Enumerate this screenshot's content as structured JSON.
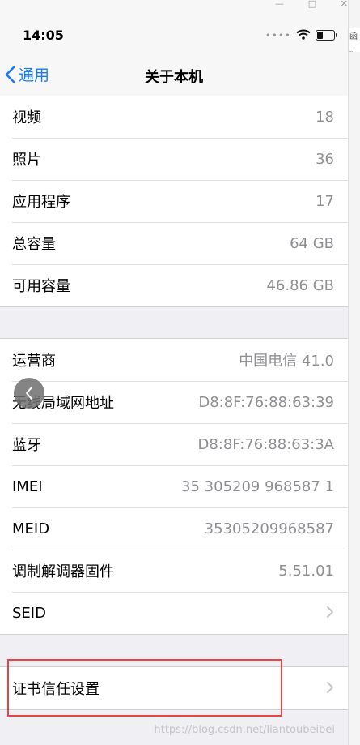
{
  "status_bar": {
    "time": "14:05",
    "signal": "••••"
  },
  "nav": {
    "back_label": "通用",
    "title": "关于本机"
  },
  "side_tab": {
    "text": "函数"
  },
  "group1": [
    {
      "label": "视频",
      "value": "18"
    },
    {
      "label": "照片",
      "value": "36"
    },
    {
      "label": "应用程序",
      "value": "17"
    },
    {
      "label": "总容量",
      "value": "64 GB"
    },
    {
      "label": "可用容量",
      "value": "46.86 GB"
    }
  ],
  "group2": [
    {
      "label": "运营商",
      "value": "中国电信 41.0"
    },
    {
      "label": "无线局域网地址",
      "value": "D8:8F:76:88:63:39"
    },
    {
      "label": "蓝牙",
      "value": "D8:8F:76:88:63:3A"
    },
    {
      "label": "IMEI",
      "value": "35 305209 968587 1"
    },
    {
      "label": "MEID",
      "value": "35305209968587"
    },
    {
      "label": "调制解调器固件",
      "value": "5.51.01"
    },
    {
      "label": "SEID",
      "value": ""
    }
  ],
  "group3": [
    {
      "label": "证书信任设置"
    }
  ],
  "watermark": "https://blog.csdn.net/liantoubeibei",
  "colors": {
    "accent": "#1a7cf5",
    "highlight": "#e64545"
  },
  "battery_level": 0.35
}
